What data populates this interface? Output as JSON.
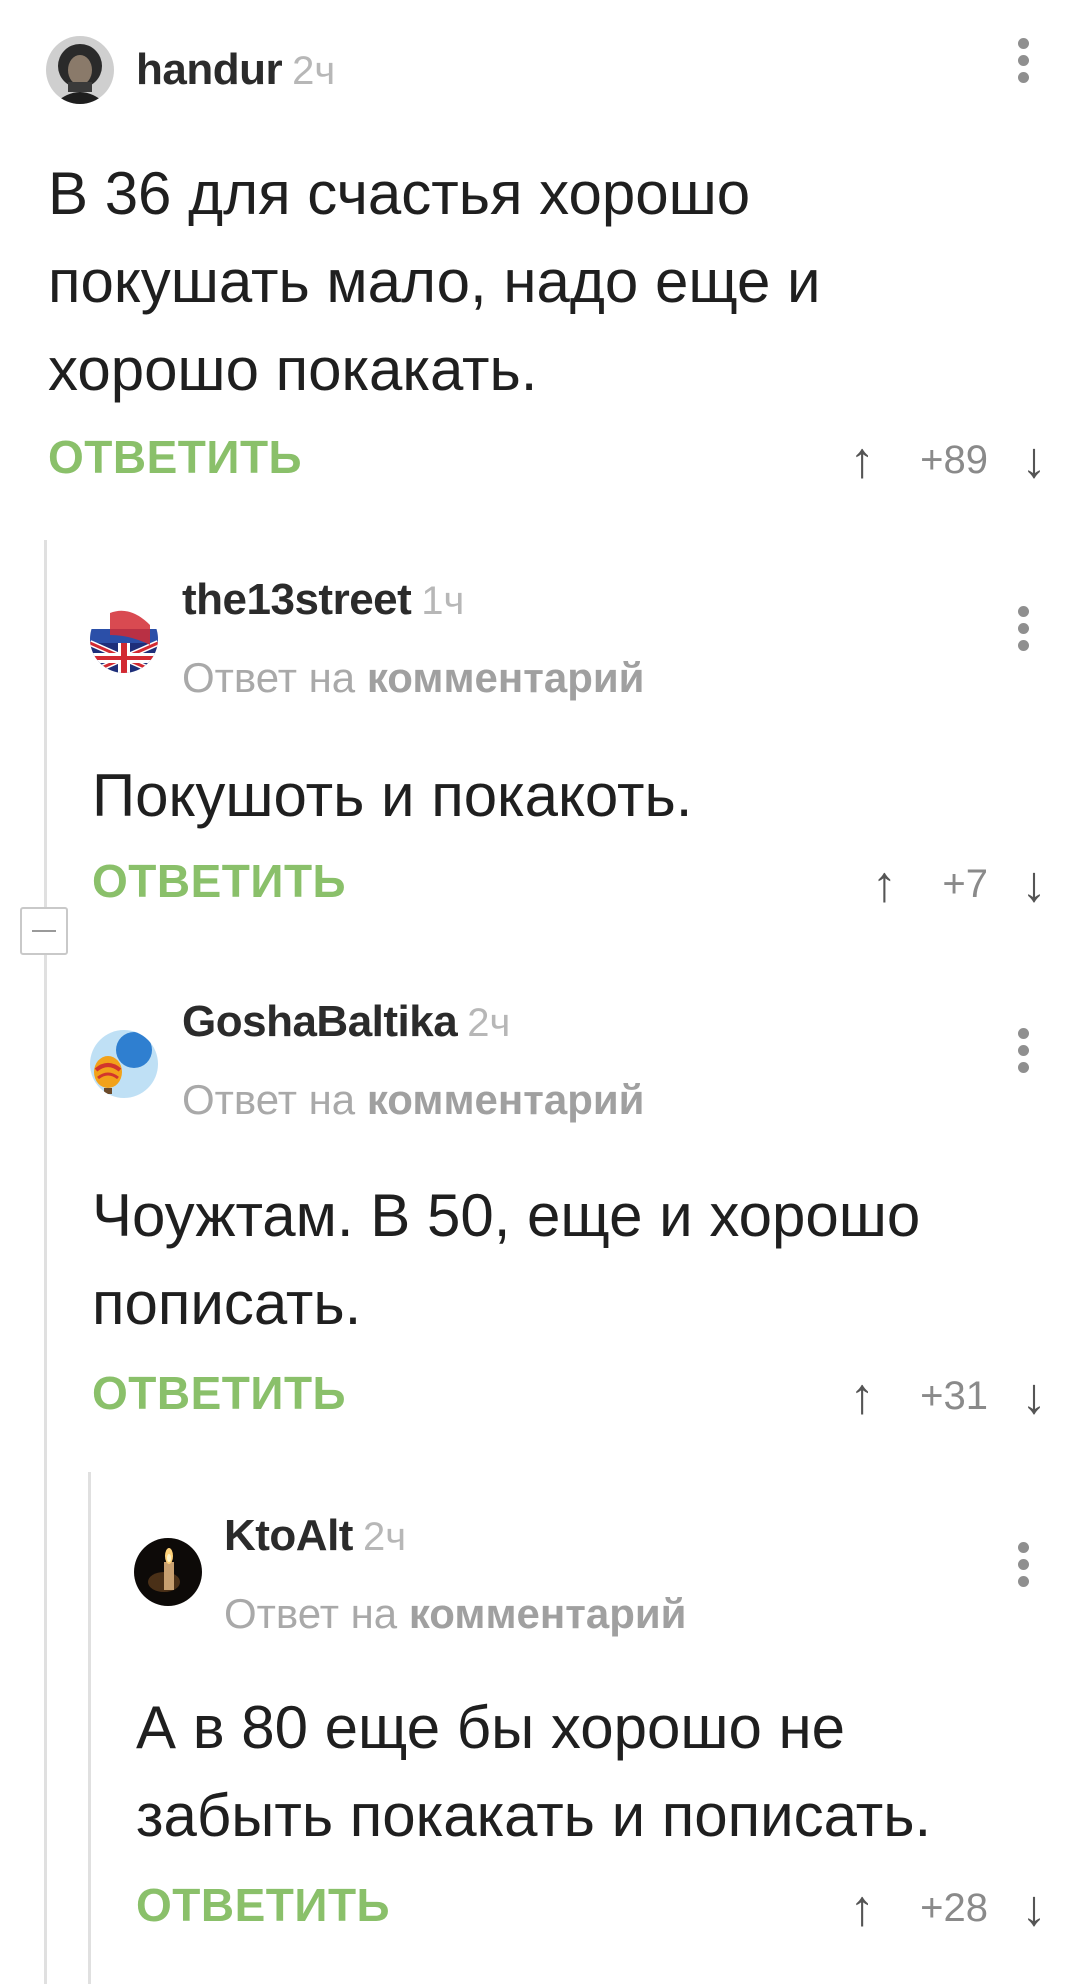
{
  "comments": [
    {
      "username": "handur",
      "time": "2ч",
      "text_lines": [
        "В 36 для счастья хорошо",
        "покушать мало, надо еще и",
        "хорошо покакать."
      ],
      "reply_label": "ОТВЕТИТЬ",
      "score": "+89",
      "avatar": "hooded-person-avatar"
    },
    {
      "username": "the13street",
      "time": "1ч",
      "reply_prefix": "Ответ на",
      "reply_target": "комментарий",
      "text_lines": [
        "Покушоть и покакоть."
      ],
      "reply_label": "ОТВЕТИТЬ",
      "score": "+7",
      "avatar": "flags-avatar"
    },
    {
      "username": "GoshaBaltika",
      "time": "2ч",
      "reply_prefix": "Ответ на",
      "reply_target": "комментарий",
      "text_lines": [
        "Чоужтам. В 50, еще и хорошо",
        "пописать."
      ],
      "reply_label": "ОТВЕТИТЬ",
      "score": "+31",
      "avatar": "hot-air-balloon-avatar"
    },
    {
      "username": "KtoAlt",
      "time": "2ч",
      "reply_prefix": "Ответ на",
      "reply_target": "комментарий",
      "text_lines": [
        "А в 80 еще бы хорошо не",
        "забыть покакать и пописать."
      ],
      "reply_label": "ОТВЕТИТЬ",
      "score": "+28",
      "avatar": "candle-avatar"
    }
  ],
  "icons": {
    "upvote": "↑",
    "downvote": "↓",
    "more": "more-vertical-icon",
    "collapse": "collapse-minus-icon"
  },
  "colors": {
    "accent_green": "#8ac06a",
    "thread_line": "#e0e0e0",
    "muted_text": "#a9a9a9"
  }
}
